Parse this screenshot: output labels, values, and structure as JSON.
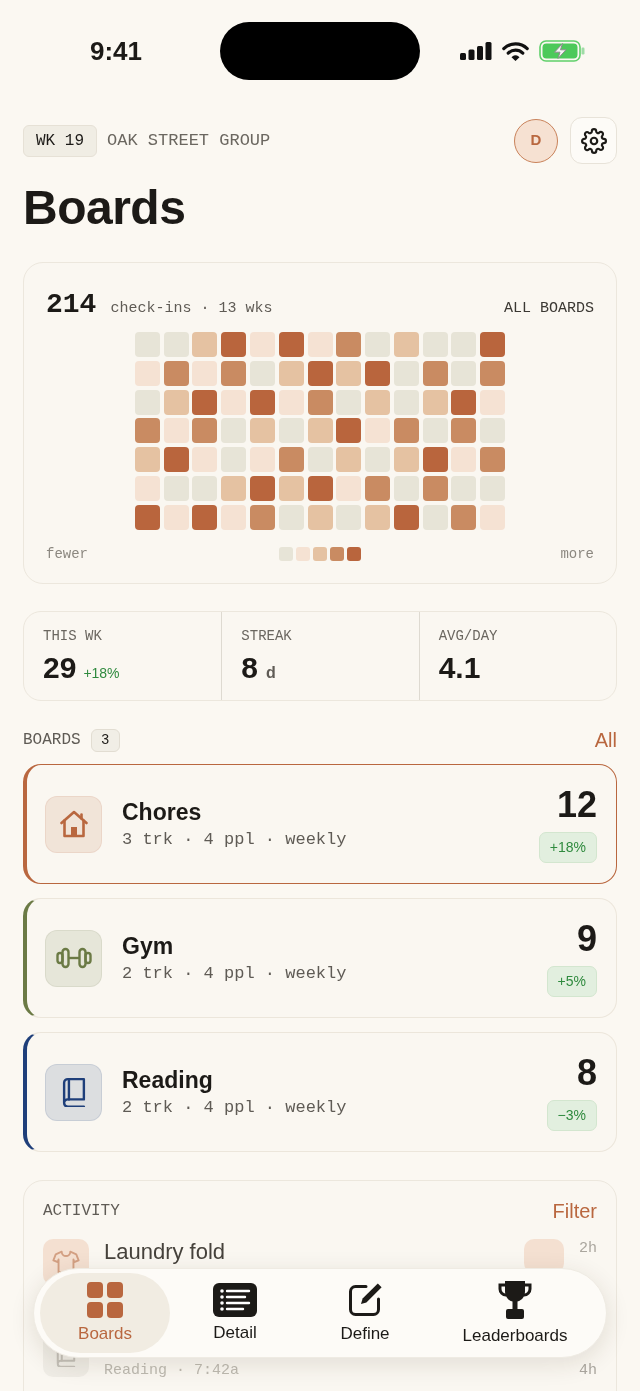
{
  "status_bar": {
    "time": "9:41"
  },
  "header": {
    "week": "WK 19",
    "group": "OAK STREET GROUP",
    "avatar": "D"
  },
  "title": "Boards",
  "heatmap": {
    "total": "214",
    "caption": "check-ins · 13 wks",
    "scope": "ALL BOARDS",
    "rows": [
      {
        "cells": [
          {
            "color": "#e7e4d7"
          },
          {
            "color": "#e7e4d7"
          },
          {
            "color": "#e5c2a2"
          },
          {
            "color": "#b9653d"
          },
          {
            "color": "#f5e2d3"
          },
          {
            "color": "#b9653d"
          },
          {
            "color": "#f5e2d3"
          },
          {
            "color": "#c98b62"
          },
          {
            "color": "#e7e4d7"
          },
          {
            "color": "#e5c2a2"
          },
          {
            "color": "#e7e4d7"
          },
          {
            "color": "#e7e4d7"
          },
          {
            "color": "#b9653d"
          }
        ]
      },
      {
        "cells": [
          {
            "color": "#f5e2d3"
          },
          {
            "color": "#c98b62"
          },
          {
            "color": "#f5e2d3"
          },
          {
            "color": "#c98b62"
          },
          {
            "color": "#e7e4d7"
          },
          {
            "color": "#e5c2a2"
          },
          {
            "color": "#b9653d"
          },
          {
            "color": "#e5c2a2"
          },
          {
            "color": "#b9653d"
          },
          {
            "color": "#e7e4d7"
          },
          {
            "color": "#c98b62"
          },
          {
            "color": "#e7e4d7"
          },
          {
            "color": "#c98b62"
          }
        ]
      },
      {
        "cells": [
          {
            "color": "#e7e4d7"
          },
          {
            "color": "#e5c2a2"
          },
          {
            "color": "#b9653d"
          },
          {
            "color": "#f5e2d3"
          },
          {
            "color": "#b9653d"
          },
          {
            "color": "#f5e2d3"
          },
          {
            "color": "#c98b62"
          },
          {
            "color": "#e7e4d7"
          },
          {
            "color": "#e5c2a2"
          },
          {
            "color": "#e7e4d7"
          },
          {
            "color": "#e5c2a2"
          },
          {
            "color": "#b9653d"
          },
          {
            "color": "#f5e2d3"
          }
        ]
      },
      {
        "cells": [
          {
            "color": "#c98b62"
          },
          {
            "color": "#f5e2d3"
          },
          {
            "color": "#c98b62"
          },
          {
            "color": "#e7e4d7"
          },
          {
            "color": "#e5c2a2"
          },
          {
            "color": "#e7e4d7"
          },
          {
            "color": "#e5c2a2"
          },
          {
            "color": "#b9653d"
          },
          {
            "color": "#f5e2d3"
          },
          {
            "color": "#c98b62"
          },
          {
            "color": "#e7e4d7"
          },
          {
            "color": "#c98b62"
          },
          {
            "color": "#e7e4d7"
          }
        ]
      },
      {
        "cells": [
          {
            "color": "#e5c2a2"
          },
          {
            "color": "#b9653d"
          },
          {
            "color": "#f5e2d3"
          },
          {
            "color": "#e7e4d7"
          },
          {
            "color": "#f5e2d3"
          },
          {
            "color": "#c98b62"
          },
          {
            "color": "#e7e4d7"
          },
          {
            "color": "#e5c2a2"
          },
          {
            "color": "#e7e4d7"
          },
          {
            "color": "#e5c2a2"
          },
          {
            "color": "#b9653d"
          },
          {
            "color": "#f5e2d3"
          },
          {
            "color": "#c98b62"
          }
        ]
      },
      {
        "cells": [
          {
            "color": "#f5e2d3"
          },
          {
            "color": "#e7e4d7"
          },
          {
            "color": "#e7e4d7"
          },
          {
            "color": "#e5c2a2"
          },
          {
            "color": "#b9653d"
          },
          {
            "color": "#e5c2a2"
          },
          {
            "color": "#b9653d"
          },
          {
            "color": "#f5e2d3"
          },
          {
            "color": "#c98b62"
          },
          {
            "color": "#e7e4d7"
          },
          {
            "color": "#c98b62"
          },
          {
            "color": "#e7e4d7"
          },
          {
            "color": "#e7e4d7"
          }
        ]
      },
      {
        "cells": [
          {
            "color": "#b9653d"
          },
          {
            "color": "#f5e2d3"
          },
          {
            "color": "#b9653d"
          },
          {
            "color": "#f5e2d3"
          },
          {
            "color": "#c98b62"
          },
          {
            "color": "#e7e4d7"
          },
          {
            "color": "#e5c2a2"
          },
          {
            "color": "#e7e4d7"
          },
          {
            "color": "#e5c2a2"
          },
          {
            "color": "#b9653d"
          },
          {
            "color": "#e7e4d7"
          },
          {
            "color": "#c98b62"
          },
          {
            "color": "#f5e2d3"
          }
        ]
      }
    ],
    "legend": {
      "low": "fewer",
      "high": "more",
      "swatches": [
        {
          "color": "#e7e4d7"
        },
        {
          "color": "#f5e2d3"
        },
        {
          "color": "#e5c2a2"
        },
        {
          "color": "#c98b62"
        },
        {
          "color": "#b9653d"
        }
      ]
    }
  },
  "stats": [
    {
      "label": "THIS WK",
      "value": "29",
      "delta": "+18%"
    },
    {
      "label": "STREAK",
      "value": "8",
      "unit": "d"
    },
    {
      "label": "AVG/DAY",
      "value": "4.1"
    }
  ],
  "boards_section": {
    "title": "BOARDS",
    "count": "3",
    "link": "All"
  },
  "boards": [
    {
      "kind": "household",
      "name": "Chores",
      "meta": "3 trk · 4 ppl · weekly",
      "count": "12",
      "delta": "+18%",
      "color": "#b9673f",
      "selected": true
    },
    {
      "kind": "fitness",
      "name": "Gym",
      "meta": "2 trk · 4 ppl · weekly",
      "count": "9",
      "delta": "+5%",
      "color": "#6b7a45",
      "selected": false
    },
    {
      "kind": "reading",
      "name": "Reading",
      "meta": "2 trk · 4 ppl · weekly",
      "count": "8",
      "delta": "−3%",
      "color": "#1f3f7a",
      "selected": false
    }
  ],
  "activity": {
    "title": "ACTIVITY",
    "action": "Filter",
    "rows": [
      {
        "kind": "laundry",
        "color": "#f4e0d1",
        "title": "Laundry fold",
        "time": "2h",
        "chip": true
      },
      {
        "kind": "reading",
        "color": "#efece5",
        "subtitle": "Reading · 7:42a",
        "time": "4h"
      }
    ]
  },
  "tab_bar": {
    "tabs": [
      {
        "kind": "overview",
        "label": "Boards",
        "selected": true
      },
      {
        "kind": "detail",
        "label": "Detail",
        "selected": false
      },
      {
        "kind": "editor",
        "label": "Define",
        "selected": false
      },
      {
        "kind": "ranking",
        "label": "Leaderboards",
        "selected": false
      }
    ]
  }
}
